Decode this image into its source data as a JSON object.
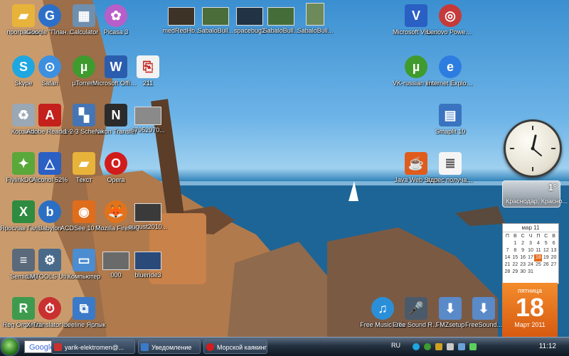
{
  "desktop": {
    "icons": [
      {
        "label": "программы",
        "icon": "folder-icon",
        "color": "#e8b33a"
      },
      {
        "label": "Google \"Планета...",
        "icon": "google-earth-icon",
        "color": "#2c6fc8"
      },
      {
        "label": "Calculator",
        "icon": "calculator-icon",
        "color": "#6f8fae"
      },
      {
        "label": "Picasa 3",
        "icon": "picasa-icon",
        "color": "#b85ec9"
      },
      {
        "label": "medRedHb...",
        "icon": "photo-thumbnail-icon",
        "color": "#3d3427"
      },
      {
        "label": "SabaloBull...",
        "icon": "photo-thumbnail-icon",
        "color": "#4a6d3a"
      },
      {
        "label": "spacebug2",
        "icon": "photo-thumbnail-icon",
        "color": "#223346"
      },
      {
        "label": "SabaloBull...",
        "icon": "photo-thumbnail-icon",
        "color": "#456d3a"
      },
      {
        "label": "SabaloBull...",
        "icon": "photo-thumbnail-icon",
        "color": "#6d8a5a"
      },
      {
        "label": "Microsoft Visio 2010",
        "icon": "visio-icon",
        "color": "#2a5fc4"
      },
      {
        "label": "Lenovo PowerDVD",
        "icon": "dvd-icon",
        "color": "#c73a3a"
      },
      {
        "label": "Skype",
        "icon": "skype-icon",
        "color": "#1ea7e1"
      },
      {
        "label": "Safari",
        "icon": "safari-icon",
        "color": "#3d8fe0"
      },
      {
        "label": "µTorrent",
        "icon": "utorrent-icon",
        "color": "#3f9b2e"
      },
      {
        "label": "Microsoft Office Wo...",
        "icon": "word-icon",
        "color": "#2b5dae"
      },
      {
        "label": "211",
        "icon": "pdf-document-icon",
        "color": "#f2f2f2"
      },
      {
        "label": "VK-russian in Nederland ...",
        "icon": "utorrent-icon",
        "color": "#3f9b2e"
      },
      {
        "label": "Internet Explorer",
        "icon": "internet-explorer-icon",
        "color": "#2d7de0"
      },
      {
        "label": "Корзина",
        "icon": "recycle-bin-icon",
        "color": "#9aa7b4"
      },
      {
        "label": "Adobe Reader 9",
        "icon": "adobe-reader-icon",
        "color": "#c4201c"
      },
      {
        "label": "1-2-3 Scheme",
        "icon": "scheme-icon",
        "color": "#4575b5"
      },
      {
        "label": "Nikon Transfer",
        "icon": "nikon-transfer-icon",
        "color": "#2b2b2b"
      },
      {
        "label": "67952970...",
        "icon": "photo-thumbnail-icon",
        "color": "#8a8a8a"
      },
      {
        "label": "Smaplit 10",
        "icon": "smaplit-icon",
        "color": "#3a74c0"
      },
      {
        "label": "FlylinkDC++",
        "icon": "flylink-icon",
        "color": "#5aa83a"
      },
      {
        "label": "Alcohol 52%",
        "icon": "alcohol-icon",
        "color": "#2a5fc4"
      },
      {
        "label": "Текст",
        "icon": "folder-icon",
        "color": "#e8b33a"
      },
      {
        "label": "Opera",
        "icon": "opera-icon",
        "color": "#d21c1c"
      },
      {
        "label": "Java Web Start",
        "icon": "java-icon",
        "color": "#e05c1c"
      },
      {
        "label": "адрес получателя",
        "icon": "text-document-icon",
        "color": "#f5f5f5"
      },
      {
        "label": "Ярослав Галыгин",
        "icon": "excel-document-icon",
        "color": "#2e8b3f"
      },
      {
        "label": "Babylon",
        "icon": "babylon-icon",
        "color": "#2a6fc4"
      },
      {
        "label": "ACDSee 10 Photo M...",
        "icon": "acdsee-icon",
        "color": "#e06d1c"
      },
      {
        "label": "Mozilla Firefox",
        "icon": "firefox-icon",
        "color": "#e0731c"
      },
      {
        "label": "august2010...",
        "icon": "photo-thumbnail-icon",
        "color": "#3a3a3a"
      },
      {
        "label": "Semiolog",
        "icon": "semiolog-icon",
        "color": "#5a6a7a"
      },
      {
        "label": "LMTOOLS Utility",
        "icon": "lmtools-icon",
        "color": "#4a6a8a"
      },
      {
        "label": "Компьютер",
        "icon": "computer-icon",
        "color": "#4c8cd0"
      },
      {
        "label": "000",
        "icon": "photo-thumbnail-icon",
        "color": "#6a6a6a"
      },
      {
        "label": "blueride3",
        "icon": "photo-thumbnail-icon",
        "color": "#2a4a7a"
      },
      {
        "label": "Reg Organizer",
        "icon": "reg-organizer-icon",
        "color": "#3e9b4e"
      },
      {
        "label": "X-Translator Discovery",
        "icon": "x-translator-icon",
        "color": "#c93030"
      },
      {
        "label": "Ibeeline Ярлык",
        "icon": "network-icon",
        "color": "#3a7ac8"
      },
      {
        "label": "Free Music Zilla",
        "icon": "free-music-zilla-icon",
        "color": "#2a8fd8"
      },
      {
        "label": "Free Sound Recorder",
        "icon": "sound-recorder-icon",
        "color": "#4a5a6a"
      },
      {
        "label": "FMZsetup",
        "icon": "setup-icon",
        "color": "#5a8ac8"
      },
      {
        "label": "FreeSound...",
        "icon": "setup-icon",
        "color": "#5a8ac8"
      }
    ]
  },
  "gadgets": {
    "weather": {
      "temp": "1°",
      "city": "Краснодар, Красно..."
    },
    "calendar": {
      "month": "мар 11",
      "weekdays": [
        "П",
        "В",
        "С",
        "Ч",
        "П",
        "С",
        "В"
      ],
      "days": [
        "",
        "1",
        "2",
        "3",
        "4",
        "5",
        "6",
        "7",
        "8",
        "9",
        "10",
        "11",
        "12",
        "13",
        "14",
        "15",
        "16",
        "17",
        "18",
        "19",
        "20",
        "21",
        "22",
        "23",
        "24",
        "25",
        "26",
        "27",
        "28",
        "29",
        "30",
        "31",
        "",
        "",
        ""
      ],
      "today": "18"
    },
    "day_card": {
      "weekday": "пятница",
      "day": "18",
      "month_year": "Март 2011"
    }
  },
  "taskbar": {
    "search_label": "Google",
    "tasks": [
      {
        "label": "yarik-elektromen@...",
        "icon": "email-icon",
        "color": "#c93030"
      },
      {
        "label": "Уведомление",
        "icon": "window-icon",
        "color": "#3a7ac8"
      },
      {
        "label": "Морской каякинг -...",
        "icon": "opera-icon",
        "color": "#d21c1c"
      }
    ],
    "language": "RU",
    "time": "11:12",
    "tray_icons": [
      "skype-icon",
      "utorrent-icon",
      "shield-icon",
      "volume-icon",
      "network-icon",
      "power-icon"
    ]
  }
}
